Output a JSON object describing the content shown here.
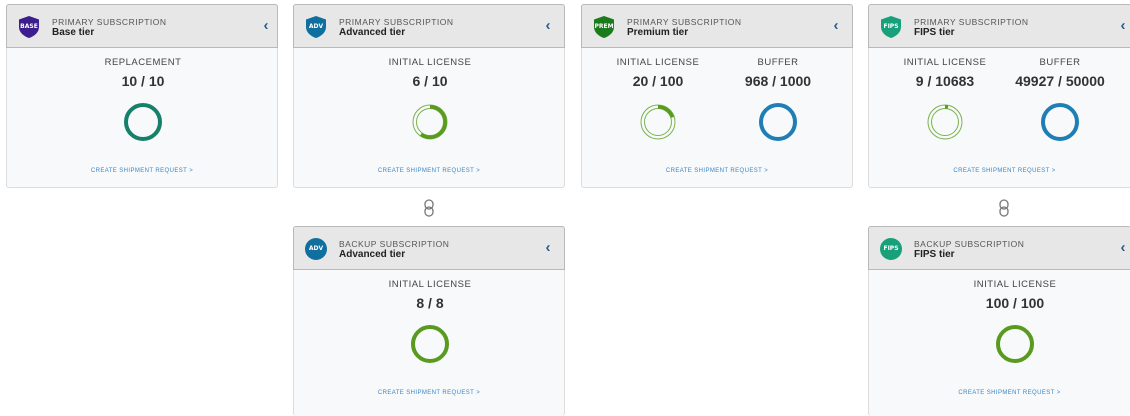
{
  "cta_label": "CREATE SHIPMENT REQUEST >",
  "collapse_glyph": "‹",
  "colors": {
    "base_badge": "#3b1d8e",
    "adv_badge": "#0f6f9e",
    "prem_badge": "#1b7a1b",
    "fips_badge": "#17a07a",
    "teal_ring": "#17806a",
    "green_ring": "#5a9a1f",
    "blue_ring": "#1f7fb5",
    "link_blue": "#3a86c8"
  },
  "cards": [
    {
      "badge": "BASE",
      "kicker": "PRIMARY SUBSCRIPTION",
      "tier": "Base tier",
      "metrics": [
        {
          "label": "REPLACEMENT",
          "value": "10 / 10",
          "fraction": 1.0,
          "style": "full-teal"
        }
      ]
    },
    {
      "badge": "ADV",
      "kicker": "PRIMARY SUBSCRIPTION",
      "tier": "Advanced tier",
      "metrics": [
        {
          "label": "INITIAL LICENSE",
          "value": "6 / 10",
          "fraction": 0.6,
          "style": "partial-green"
        }
      ]
    },
    {
      "badge": "PREM",
      "kicker": "PRIMARY SUBSCRIPTION",
      "tier": "Premium tier",
      "metrics": [
        {
          "label": "INITIAL LICENSE",
          "value": "20 / 100",
          "fraction": 0.2,
          "style": "partial-green"
        },
        {
          "label": "BUFFER",
          "value": "968 / 1000",
          "fraction": 0.968,
          "style": "full-blue"
        }
      ]
    },
    {
      "badge": "FIPS",
      "kicker": "PRIMARY SUBSCRIPTION",
      "tier": "FIPS tier",
      "metrics": [
        {
          "label": "INITIAL LICENSE",
          "value": "9 / 10683",
          "fraction": 0.001,
          "style": "partial-green"
        },
        {
          "label": "BUFFER",
          "value": "49927 / 50000",
          "fraction": 0.9985,
          "style": "full-blue"
        }
      ]
    },
    {
      "badge": "ADV",
      "kicker": "BACKUP SUBSCRIPTION",
      "tier": "Advanced tier",
      "metrics": [
        {
          "label": "INITIAL LICENSE",
          "value": "8 / 8",
          "fraction": 1.0,
          "style": "full-green"
        }
      ]
    },
    {
      "badge": "FIPS",
      "kicker": "BACKUP SUBSCRIPTION",
      "tier": "FIPS tier",
      "metrics": [
        {
          "label": "INITIAL LICENSE",
          "value": "100 / 100",
          "fraction": 1.0,
          "style": "full-green"
        }
      ]
    }
  ]
}
